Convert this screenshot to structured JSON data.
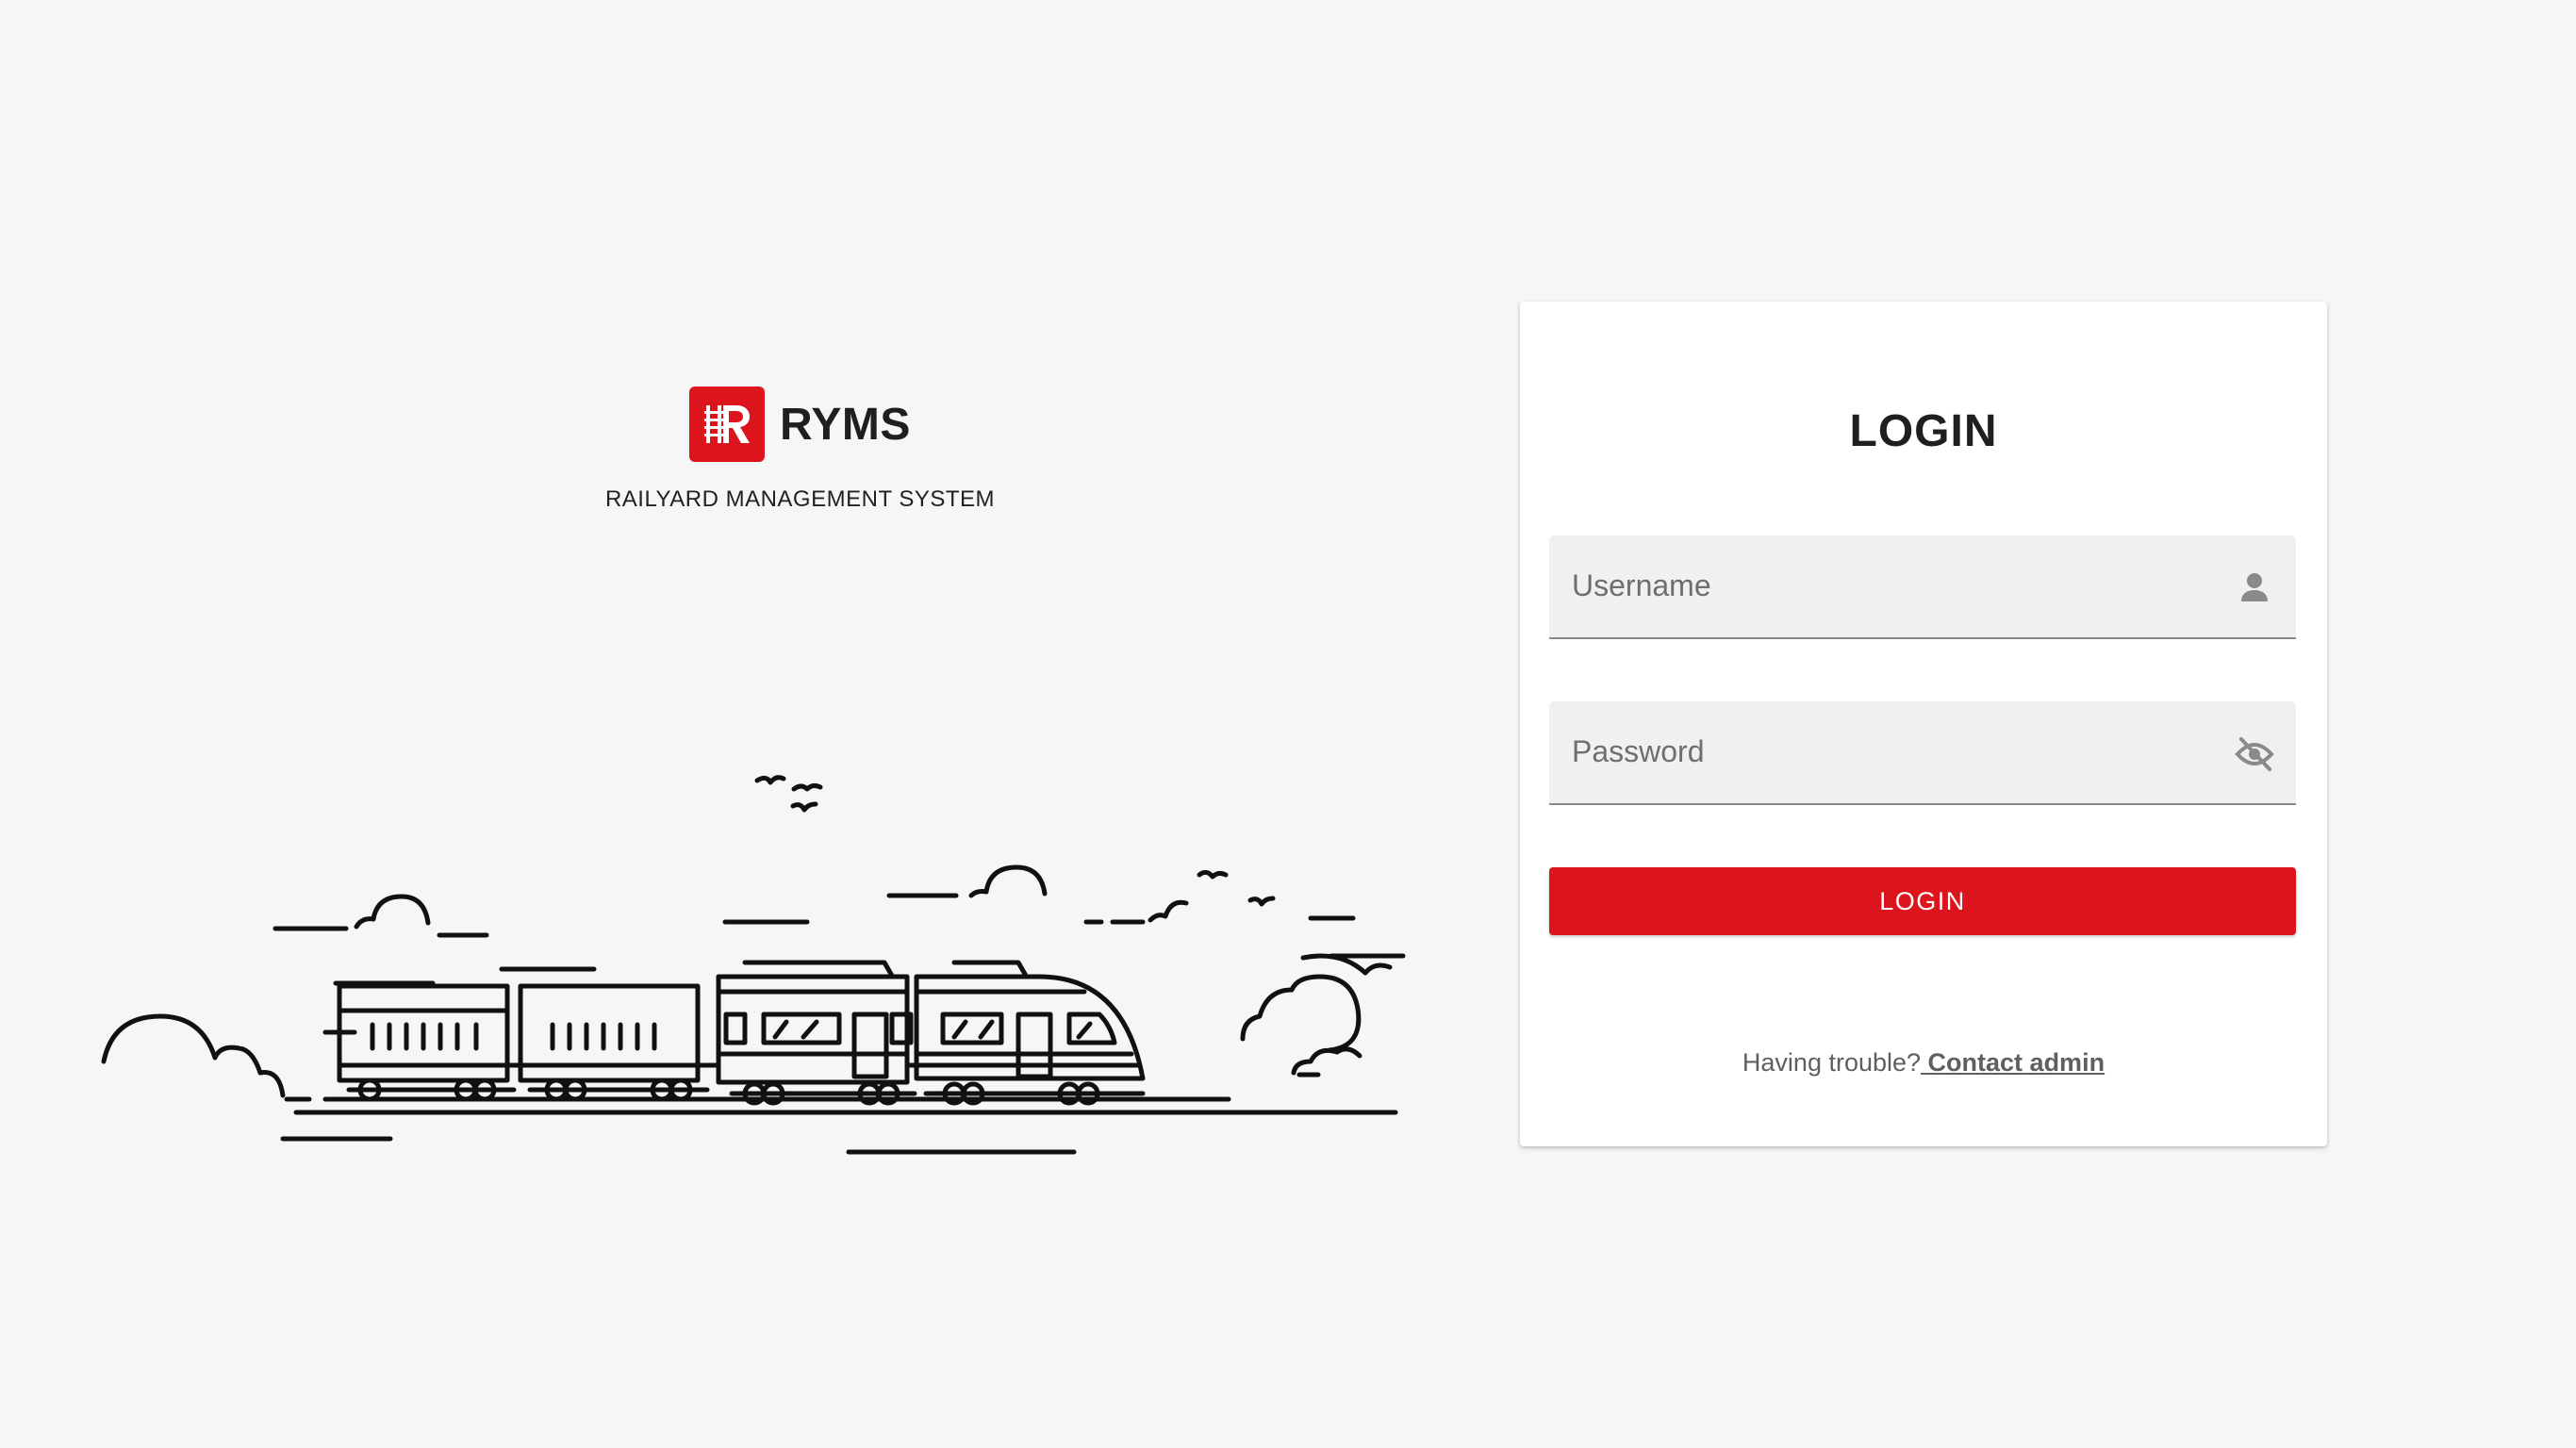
{
  "brand": {
    "name": "RYMS",
    "tagline": "RAILYARD MANAGEMENT SYSTEM",
    "logo_letter": "R",
    "accent_color": "#dc141d"
  },
  "login": {
    "title": "LOGIN",
    "username": {
      "placeholder": "Username",
      "value": "",
      "icon": "person-icon"
    },
    "password": {
      "placeholder": "Password",
      "value": "",
      "icon": "eye-off-icon"
    },
    "button_label": "LOGIN",
    "help_text": "Having trouble?",
    "help_link": " Contact admin"
  },
  "illustration": {
    "icon": "train-illustration"
  }
}
